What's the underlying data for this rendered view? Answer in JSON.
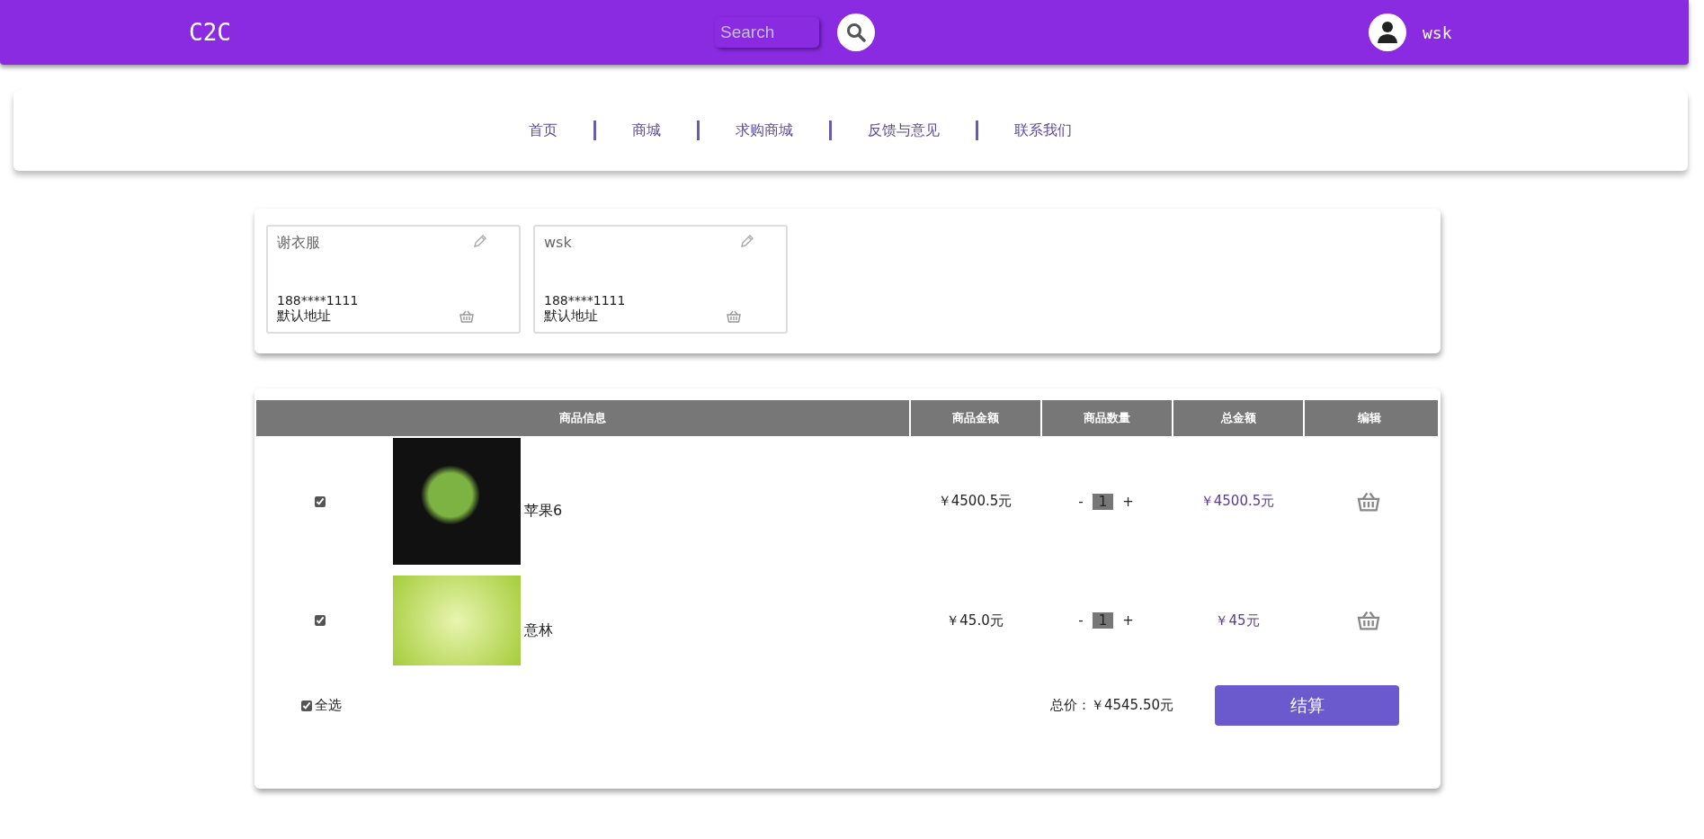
{
  "header": {
    "logo": "C2C",
    "search": {
      "placeholder": "Search"
    },
    "user": "wsk"
  },
  "nav": [
    {
      "label": "首页"
    },
    {
      "label": "商城"
    },
    {
      "label": "求购商城"
    },
    {
      "label": "反馈与意见"
    },
    {
      "label": "联系我们"
    }
  ],
  "addresses": [
    {
      "name": "谢衣服",
      "phone": "188****1111",
      "tag": "默认地址"
    },
    {
      "name": "wsk",
      "phone": "188****1111",
      "tag": "默认地址"
    }
  ],
  "cart": {
    "columns": [
      "商品信息",
      "商品金额",
      "商品数量",
      "总金额",
      "编辑"
    ],
    "items": [
      {
        "checked": true,
        "name": "苹果6",
        "price": "￥4500.5元",
        "minus": "-",
        "quantity": "1",
        "plus": "+",
        "total": "￥4500.5元"
      },
      {
        "checked": true,
        "name": "意林",
        "price": "￥45.0元",
        "minus": "-",
        "quantity": "1",
        "plus": "+",
        "total": "￥45元"
      }
    ],
    "select_all": {
      "label": "全选",
      "checked": true
    },
    "total": "总价：￥4545.50元",
    "checkout": "结算"
  }
}
